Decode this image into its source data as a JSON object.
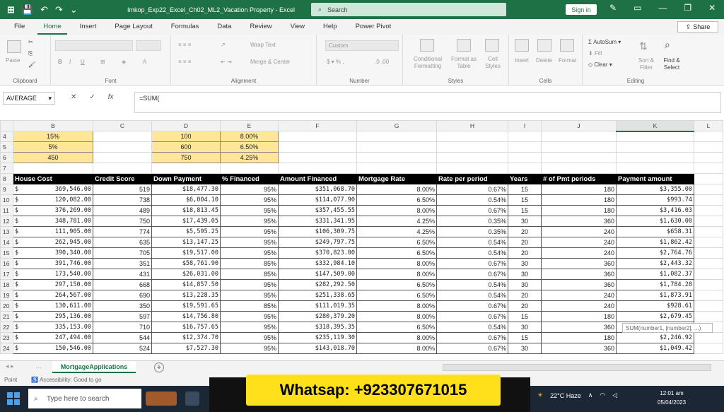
{
  "titlebar": {
    "doc_title": "Imkop_Exp22_Excel_Ch02_ML2_Vacation Property - Excel",
    "search_placeholder": "Search",
    "signin_label": "Sign in"
  },
  "ribbon_tabs": [
    "File",
    "Home",
    "Insert",
    "Page Layout",
    "Formulas",
    "Data",
    "Review",
    "View",
    "Help",
    "Power Pivot"
  ],
  "share_label": "Share",
  "ribbon": {
    "clipboard": {
      "paste": "Paste",
      "label": "Clipboard"
    },
    "font": {
      "label": "Font"
    },
    "alignment": {
      "wrap": "Wrap Text",
      "merge": "Merge & Center",
      "label": "Alignment"
    },
    "number": {
      "format": "Custom",
      "label": "Number"
    },
    "styles": {
      "conditional": "Conditional Formatting",
      "format_table": "Format as Table",
      "cell_styles": "Cell Styles",
      "label": "Styles"
    },
    "cells": {
      "insert": "Insert",
      "delete": "Delete",
      "format": "Format",
      "label": "Cells"
    },
    "editing": {
      "autosum": "AutoSum",
      "fill": "Fill",
      "clear": "Clear",
      "sort": "Sort & Filter",
      "find": "Find & Select",
      "label": "Editing"
    }
  },
  "formula_bar": {
    "name_box": "AVERAGE",
    "formula": "=SUM("
  },
  "columns": [
    "B",
    "C",
    "D",
    "E",
    "F",
    "G",
    "H",
    "I",
    "J",
    "K",
    "L"
  ],
  "top_rows": [
    {
      "row": "4",
      "b": "15%",
      "d": "100",
      "e": "8.00%"
    },
    {
      "row": "5",
      "b": "5%",
      "d": "600",
      "e": "6.50%"
    },
    {
      "row": "6",
      "b": "450",
      "d": "750",
      "e": "4.25%"
    },
    {
      "row": "7",
      "b": "",
      "d": "",
      "e": ""
    }
  ],
  "headers": [
    "House Cost",
    "Credit Score",
    "Down Payment",
    "% Financed",
    "Amount Financed",
    "Mortgage Rate",
    "Rate per period",
    "Years",
    "# of Pmt periods",
    "Payment amount"
  ],
  "header_row": "8",
  "rows": [
    {
      "row": "9",
      "cost": "369,546.00",
      "score": "519",
      "down": "$18,477.30",
      "fin": "95%",
      "amt": "$351,068.70",
      "rate": "8.00%",
      "rpp": "0.67%",
      "yrs": "15",
      "pmts": "180",
      "pay": "$3,355.00"
    },
    {
      "row": "10",
      "cost": "120,082.00",
      "score": "738",
      "down": "$6,004.10",
      "fin": "95%",
      "amt": "$114,077.90",
      "rate": "6.50%",
      "rpp": "0.54%",
      "yrs": "15",
      "pmts": "180",
      "pay": "$993.74"
    },
    {
      "row": "11",
      "cost": "376,269.00",
      "score": "489",
      "down": "$18,813.45",
      "fin": "95%",
      "amt": "$357,455.55",
      "rate": "8.00%",
      "rpp": "0.67%",
      "yrs": "15",
      "pmts": "180",
      "pay": "$3,416.03"
    },
    {
      "row": "12",
      "cost": "348,781.00",
      "score": "750",
      "down": "$17,439.05",
      "fin": "95%",
      "amt": "$331,341.95",
      "rate": "4.25%",
      "rpp": "0.35%",
      "yrs": "30",
      "pmts": "360",
      "pay": "$1,630.00"
    },
    {
      "row": "13",
      "cost": "111,905.00",
      "score": "774",
      "down": "$5,595.25",
      "fin": "95%",
      "amt": "$106,309.75",
      "rate": "4.25%",
      "rpp": "0.35%",
      "yrs": "20",
      "pmts": "240",
      "pay": "$658.31"
    },
    {
      "row": "14",
      "cost": "262,945.00",
      "score": "635",
      "down": "$13,147.25",
      "fin": "95%",
      "amt": "$249,797.75",
      "rate": "6.50%",
      "rpp": "0.54%",
      "yrs": "20",
      "pmts": "240",
      "pay": "$1,862.42"
    },
    {
      "row": "15",
      "cost": "390,340.00",
      "score": "705",
      "down": "$19,517.00",
      "fin": "95%",
      "amt": "$370,823.00",
      "rate": "6.50%",
      "rpp": "0.54%",
      "yrs": "20",
      "pmts": "240",
      "pay": "$2,764.76"
    },
    {
      "row": "16",
      "cost": "391,746.00",
      "score": "351",
      "down": "$58,761.90",
      "fin": "85%",
      "amt": "$332,984.10",
      "rate": "8.00%",
      "rpp": "0.67%",
      "yrs": "30",
      "pmts": "360",
      "pay": "$2,443.32"
    },
    {
      "row": "17",
      "cost": "173,540.00",
      "score": "431",
      "down": "$26,031.00",
      "fin": "85%",
      "amt": "$147,509.00",
      "rate": "8.00%",
      "rpp": "0.67%",
      "yrs": "30",
      "pmts": "360",
      "pay": "$1,082.37"
    },
    {
      "row": "18",
      "cost": "297,150.00",
      "score": "668",
      "down": "$14,857.50",
      "fin": "95%",
      "amt": "$282,292.50",
      "rate": "6.50%",
      "rpp": "0.54%",
      "yrs": "30",
      "pmts": "360",
      "pay": "$1,784.28"
    },
    {
      "row": "19",
      "cost": "264,567.00",
      "score": "690",
      "down": "$13,228.35",
      "fin": "95%",
      "amt": "$251,338.65",
      "rate": "6.50%",
      "rpp": "0.54%",
      "yrs": "20",
      "pmts": "240",
      "pay": "$1,873.91"
    },
    {
      "row": "20",
      "cost": "130,611.00",
      "score": "350",
      "down": "$19,591.65",
      "fin": "85%",
      "amt": "$111,019.35",
      "rate": "8.00%",
      "rpp": "0.67%",
      "yrs": "20",
      "pmts": "240",
      "pay": "$928.61"
    },
    {
      "row": "21",
      "cost": "295,136.00",
      "score": "597",
      "down": "$14,756.80",
      "fin": "95%",
      "amt": "$280,379.20",
      "rate": "8.00%",
      "rpp": "0.67%",
      "yrs": "15",
      "pmts": "180",
      "pay": "$2,679.45"
    },
    {
      "row": "22",
      "cost": "335,153.00",
      "score": "710",
      "down": "$16,757.65",
      "fin": "95%",
      "amt": "$318,395.35",
      "rate": "6.50%",
      "rpp": "0.54%",
      "yrs": "30",
      "pmts": "360",
      "pay": ""
    },
    {
      "row": "23",
      "cost": "247,494.00",
      "score": "544",
      "down": "$12,374.70",
      "fin": "95%",
      "amt": "$235,119.30",
      "rate": "8.00%",
      "rpp": "0.67%",
      "yrs": "15",
      "pmts": "180",
      "pay": "$2,246.92"
    },
    {
      "row": "24",
      "cost": "150,546.00",
      "score": "524",
      "down": "$7,527.30",
      "fin": "95%",
      "amt": "$143,018.70",
      "rate": "8.00%",
      "rpp": "0.67%",
      "yrs": "30",
      "pmts": "360",
      "pay": "$1,049.42"
    }
  ],
  "tooltip": "SUM(number1, [number2], ...)",
  "sheet_tab": "MortgageApplications",
  "status": {
    "mode": "Point",
    "accessibility": "Accessibility: Good to go"
  },
  "taskbar": {
    "search_placeholder": "Type here to search",
    "weather": "22°C  Haze",
    "time": "12:01 am",
    "date": "05/04/2023"
  },
  "watermark": "Whatsap: +923307671015",
  "colors": {
    "excel_green": "#1e7145",
    "highlight_yellow": "#ffe699",
    "watermark_yellow": "#ffe01a"
  }
}
